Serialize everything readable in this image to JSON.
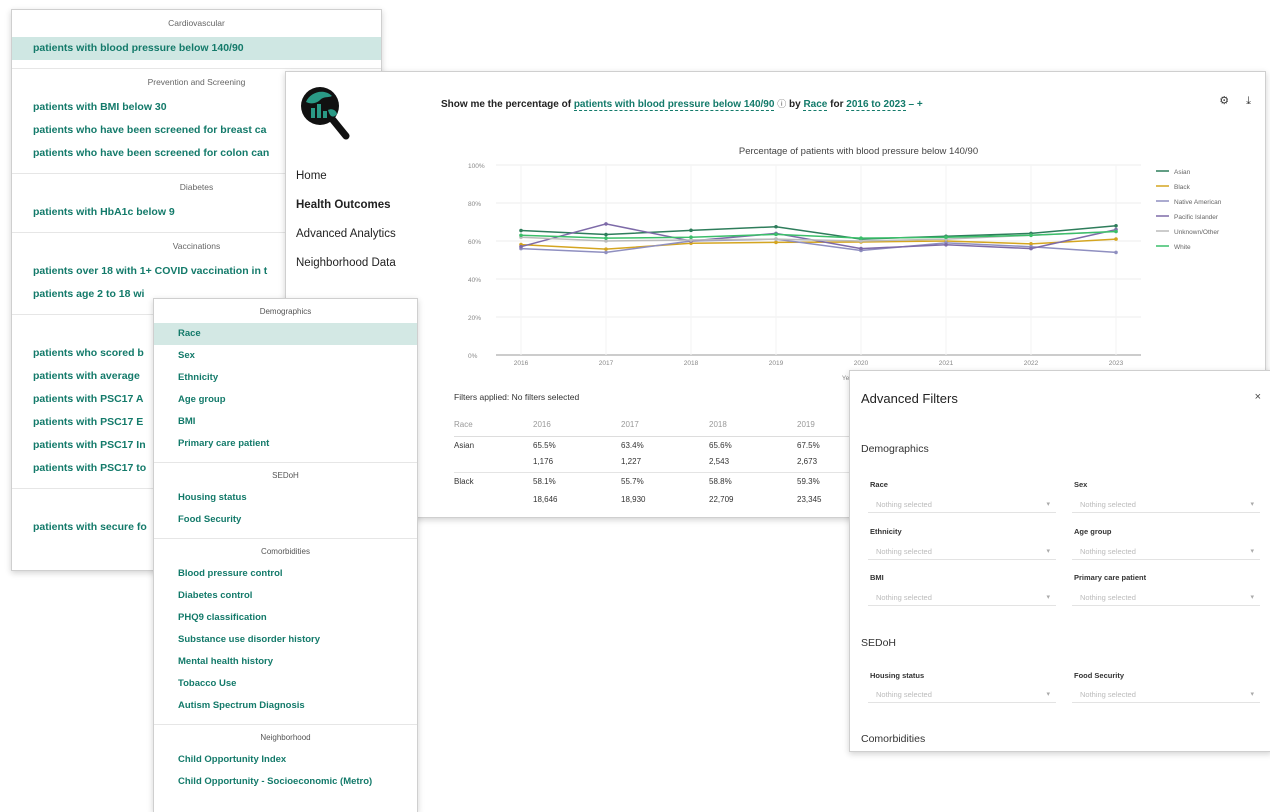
{
  "measures_menu": {
    "groups": [
      {
        "heading": "Cardiovascular",
        "items": [
          {
            "label": "patients with blood pressure below 140/90",
            "selected": true
          }
        ]
      },
      {
        "heading": "Prevention and Screening",
        "items": [
          {
            "label": "patients with BMI below 30"
          },
          {
            "label": "patients who have been screened for breast ca"
          },
          {
            "label": "patients who have been screened for colon can"
          }
        ]
      },
      {
        "heading": "Diabetes",
        "items": [
          {
            "label": "patients with HbA1c below 9"
          }
        ]
      },
      {
        "heading": "Vaccinations",
        "items": [
          {
            "label": "patients over 18 with 1+ COVID vaccination in t"
          },
          {
            "label": "patients age 2 to 18 wi"
          }
        ]
      },
      {
        "heading": "",
        "items": [
          {
            "label": "patients who scored b"
          },
          {
            "label": "patients with average"
          },
          {
            "label": "patients with PSC17 A"
          },
          {
            "label": "patients with PSC17 E"
          },
          {
            "label": "patients with PSC17 In"
          },
          {
            "label": "patients with PSC17 to"
          }
        ]
      },
      {
        "heading": "",
        "items": [
          {
            "label": "patients with secure fo"
          }
        ]
      }
    ]
  },
  "app": {
    "query": {
      "prefix": "Show me the percentage of",
      "measure": "patients with blood pressure below 140/90",
      "info_icon": "ⓘ",
      "by_text": "by",
      "group_by": "Race",
      "for_text": "for",
      "period": "2016 to 2023",
      "minus_icon": "–",
      "plus_icon": "+"
    },
    "settings_icon": "⚙",
    "download_icon": "⤓",
    "nav": [
      {
        "label": "Home",
        "active": false
      },
      {
        "label": "Health Outcomes",
        "active": true
      },
      {
        "label": "Advanced Analytics",
        "active": false
      },
      {
        "label": "Neighborhood Data",
        "active": false
      }
    ],
    "filters_applied": "Filters applied: No filters selected",
    "table": {
      "headers": [
        "Race",
        "2016",
        "2017",
        "2018",
        "2019"
      ],
      "rows": [
        {
          "race": "Asian",
          "pct": [
            "65.5%",
            "63.4%",
            "65.6%",
            "67.5%"
          ],
          "count": [
            "1,176",
            "1,227",
            "2,543",
            "2,673"
          ]
        },
        {
          "race": "Black",
          "pct": [
            "58.1%",
            "55.7%",
            "58.8%",
            "59.3%"
          ],
          "count": [
            "18,646",
            "18,930",
            "22,709",
            "23,345"
          ]
        }
      ]
    }
  },
  "chart_data": {
    "type": "line",
    "title": "Percentage of patients with blood pressure below 140/90",
    "xlabel": "Year",
    "ylabel": "",
    "x": [
      2016,
      2017,
      2018,
      2019,
      2020,
      2021,
      2022,
      2023
    ],
    "ylim": [
      0,
      100
    ],
    "yticks": [
      0,
      20,
      40,
      60,
      80,
      100
    ],
    "ytick_labels": [
      "0%",
      "20%",
      "40%",
      "60%",
      "80%",
      "100%"
    ],
    "grid": true,
    "legend": "right",
    "series": [
      {
        "name": "Asian",
        "color": "#2e7d5b",
        "values": [
          65.5,
          63.4,
          65.6,
          67.5,
          61.0,
          62.5,
          64.0,
          68.0
        ]
      },
      {
        "name": "Black",
        "color": "#d4a520",
        "values": [
          58.1,
          55.7,
          58.8,
          59.3,
          59.5,
          60.0,
          58.5,
          61.0
        ]
      },
      {
        "name": "Native American",
        "color": "#8f8fc0",
        "values": [
          56.0,
          54.0,
          60.0,
          61.0,
          55.0,
          59.0,
          57.0,
          54.0
        ]
      },
      {
        "name": "Pacific Islander",
        "color": "#7d6aa8",
        "values": [
          57.0,
          69.0,
          60.0,
          64.0,
          56.0,
          58.0,
          56.0,
          66.0
        ]
      },
      {
        "name": "Unknown/Other",
        "color": "#bbbbbb",
        "values": [
          62.0,
          60.0,
          60.5,
          61.0,
          60.0,
          61.0,
          63.0,
          65.0
        ]
      },
      {
        "name": "White",
        "color": "#3bbf6a",
        "values": [
          63.0,
          61.5,
          62.0,
          63.5,
          61.5,
          62.0,
          63.0,
          65.0
        ]
      }
    ]
  },
  "category_menu": {
    "groups": [
      {
        "heading": "Demographics",
        "items": [
          {
            "label": "Race",
            "selected": true
          },
          {
            "label": "Sex"
          },
          {
            "label": "Ethnicity"
          },
          {
            "label": "Age group"
          },
          {
            "label": "BMI"
          },
          {
            "label": "Primary care patient"
          }
        ]
      },
      {
        "heading": "SEDoH",
        "items": [
          {
            "label": "Housing status"
          },
          {
            "label": "Food Security"
          }
        ]
      },
      {
        "heading": "Comorbidities",
        "items": [
          {
            "label": "Blood pressure control"
          },
          {
            "label": "Diabetes control"
          },
          {
            "label": "PHQ9 classification"
          },
          {
            "label": "Substance use disorder history"
          },
          {
            "label": "Mental health history"
          },
          {
            "label": "Tobacco Use"
          },
          {
            "label": "Autism Spectrum Diagnosis"
          }
        ]
      },
      {
        "heading": "Neighborhood",
        "items": [
          {
            "label": "Child Opportunity Index"
          },
          {
            "label": "Child Opportunity - Socioeconomic (Metro)"
          }
        ]
      }
    ]
  },
  "advanced_filters": {
    "title": "Advanced Filters",
    "close_icon": "×",
    "placeholder": "Nothing selected",
    "caret": "▾",
    "sections": {
      "demographics": "Demographics",
      "sedoh": "SEDoH",
      "comorbidities": "Comorbidities"
    },
    "fields": {
      "race": "Race",
      "sex": "Sex",
      "ethnicity": "Ethnicity",
      "age_group": "Age group",
      "bmi": "BMI",
      "primary_care": "Primary care patient",
      "housing": "Housing status",
      "food_security": "Food Security"
    }
  }
}
